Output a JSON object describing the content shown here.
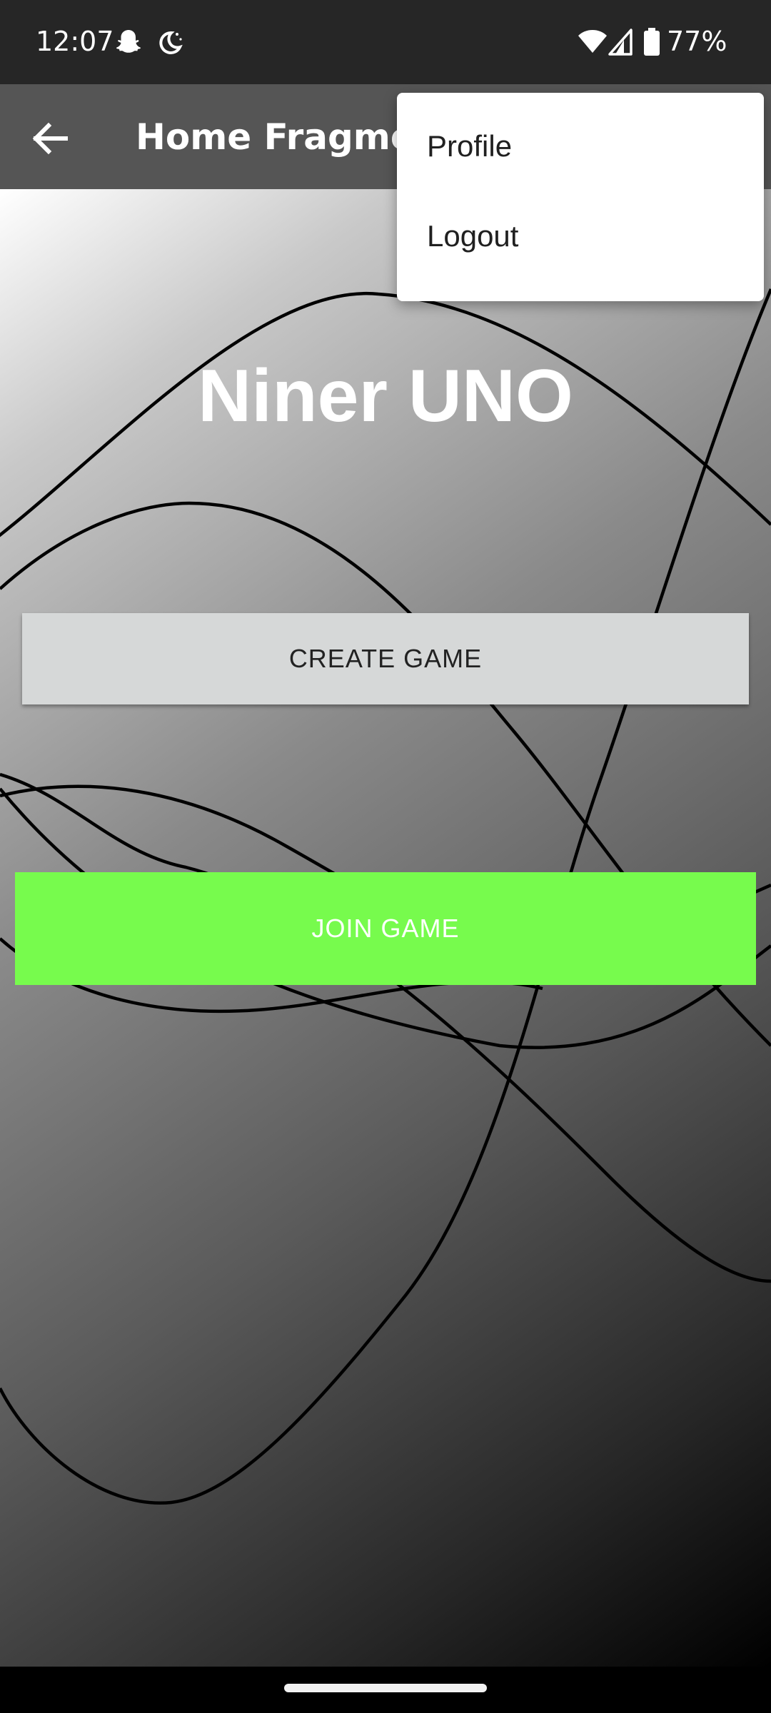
{
  "status_bar": {
    "time": "12:07",
    "battery": "77%",
    "icons": [
      "snapchat-icon",
      "do-not-disturb-moon-icon",
      "wifi-icon",
      "cell-signal-icon",
      "battery-icon"
    ]
  },
  "app_bar": {
    "title": "Home Fragment",
    "back_icon": "arrow-back-icon"
  },
  "main": {
    "title": "Niner UNO",
    "create_button_label": "CREATE GAME",
    "join_button_label": "JOIN GAME"
  },
  "overflow_menu": {
    "items": [
      {
        "label": "Profile"
      },
      {
        "label": "Logout"
      }
    ]
  },
  "colors": {
    "status_bar": "#262626",
    "app_bar": "#555555",
    "create_button": "#d6d8d8",
    "join_button": "#77fb4d",
    "menu_background": "#ffffff"
  }
}
